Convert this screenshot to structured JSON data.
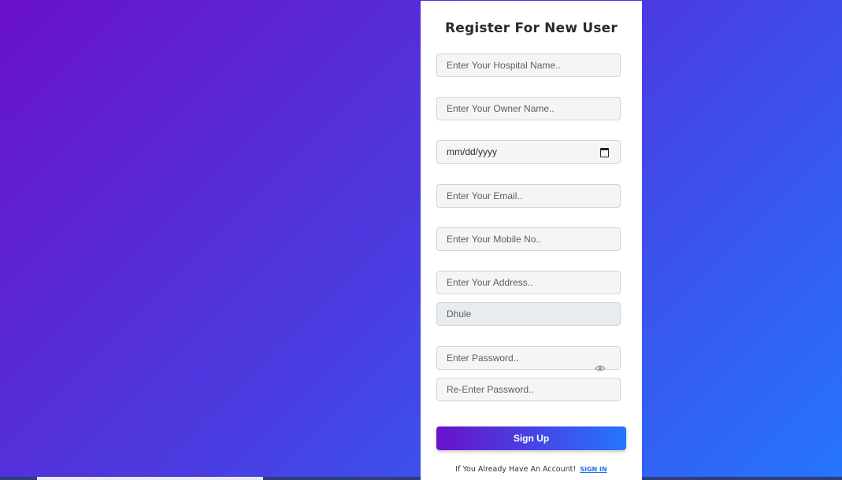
{
  "form": {
    "title": "Register For New User",
    "fields": {
      "hospital_name": {
        "placeholder": "Enter Your Hospital Name.."
      },
      "owner_name": {
        "placeholder": "Enter Your Owner Name.."
      },
      "date": {
        "value": "mm/dd/yyyy"
      },
      "email": {
        "placeholder": "Enter Your Email.."
      },
      "mobile": {
        "placeholder": "Enter Your Mobile No.."
      },
      "address": {
        "placeholder": "Enter Your Address.."
      },
      "city": {
        "value": "Dhule"
      },
      "password": {
        "placeholder": "Enter Password.."
      },
      "reenter_password": {
        "placeholder": "Re-Enter Password.."
      }
    },
    "submit_label": "Sign Up",
    "account_prompt": "If You Already Have An Account!",
    "signin_label": "SIGN IN"
  },
  "icons": {
    "calendar": "calendar-icon",
    "password_toggle": "eye-icon"
  },
  "colors": {
    "gradient_start": "#6a11cb",
    "gradient_end": "#2575fc",
    "link": "#1a73e8"
  }
}
